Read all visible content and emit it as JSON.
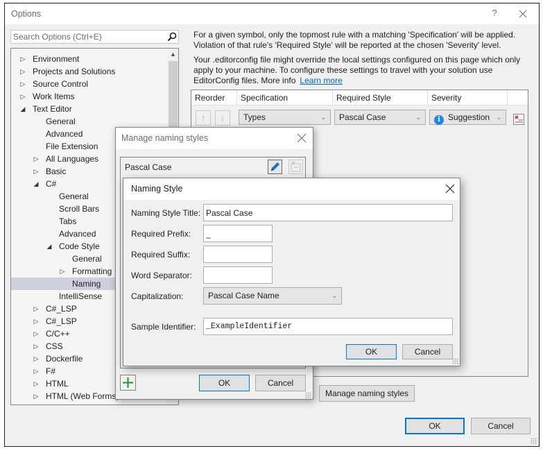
{
  "window": {
    "title": "Options",
    "help_label": "?",
    "close_icon": "close-icon"
  },
  "search": {
    "placeholder": "Search Options (Ctrl+E)",
    "value": ""
  },
  "tree": {
    "items": [
      {
        "label": "Environment",
        "level": 0,
        "arrow": "collapsed"
      },
      {
        "label": "Projects and Solutions",
        "level": 0,
        "arrow": "collapsed"
      },
      {
        "label": "Source Control",
        "level": 0,
        "arrow": "collapsed"
      },
      {
        "label": "Work Items",
        "level": 0,
        "arrow": "collapsed"
      },
      {
        "label": "Text Editor",
        "level": 0,
        "arrow": "expanded"
      },
      {
        "label": "General",
        "level": 1,
        "arrow": "none"
      },
      {
        "label": "Advanced",
        "level": 1,
        "arrow": "none"
      },
      {
        "label": "File Extension",
        "level": 1,
        "arrow": "none"
      },
      {
        "label": "All Languages",
        "level": 1,
        "arrow": "collapsed"
      },
      {
        "label": "Basic",
        "level": 1,
        "arrow": "collapsed"
      },
      {
        "label": "C#",
        "level": 1,
        "arrow": "expanded"
      },
      {
        "label": "General",
        "level": 2,
        "arrow": "none"
      },
      {
        "label": "Scroll Bars",
        "level": 2,
        "arrow": "none"
      },
      {
        "label": "Tabs",
        "level": 2,
        "arrow": "none"
      },
      {
        "label": "Advanced",
        "level": 2,
        "arrow": "none"
      },
      {
        "label": "Code Style",
        "level": 2,
        "arrow": "expanded"
      },
      {
        "label": "General",
        "level": 3,
        "arrow": "none"
      },
      {
        "label": "Formatting",
        "level": 3,
        "arrow": "collapsed"
      },
      {
        "label": "Naming",
        "level": 3,
        "arrow": "none",
        "selected": true
      },
      {
        "label": "IntelliSense",
        "level": 2,
        "arrow": "none"
      },
      {
        "label": "C#_LSP",
        "level": 1,
        "arrow": "collapsed"
      },
      {
        "label": "C#_LSP",
        "level": 1,
        "arrow": "collapsed"
      },
      {
        "label": "C/C++",
        "level": 1,
        "arrow": "collapsed"
      },
      {
        "label": "CSS",
        "level": 1,
        "arrow": "collapsed"
      },
      {
        "label": "Dockerfile",
        "level": 1,
        "arrow": "collapsed"
      },
      {
        "label": "F#",
        "level": 1,
        "arrow": "collapsed"
      },
      {
        "label": "HTML",
        "level": 1,
        "arrow": "collapsed"
      },
      {
        "label": "HTML (Web Forms)",
        "level": 1,
        "arrow": "collapsed"
      }
    ]
  },
  "content": {
    "description_1": "For a given symbol, only the topmost rule with a matching 'Specification' will be applied. Violation of that rule's 'Required Style' will be reported at the chosen 'Severity' level.",
    "description_2": "Your .editorconfig file might override the local settings configured on this page which only apply to your machine. To configure these settings to travel with your solution use EditorConfig files. More info",
    "learn_more": "Learn more",
    "grid": {
      "columns": [
        "Reorder",
        "Specification",
        "Required Style",
        "Severity"
      ],
      "rows": [
        {
          "specification": "Types",
          "required_style": "Pascal Case",
          "severity": "Suggestion"
        }
      ]
    },
    "manage_naming_styles_label": "Manage naming styles",
    "ok_label": "OK",
    "cancel_label": "Cancel"
  },
  "manage_dialog": {
    "title": "Manage naming styles",
    "items": [
      "Pascal Case"
    ],
    "ok_label": "OK",
    "cancel_label": "Cancel"
  },
  "naming_dialog": {
    "title": "Naming Style",
    "fields": {
      "title_label": "Naming Style Title:",
      "title_value": "Pascal Case",
      "prefix_label": "Required Prefix:",
      "prefix_value": "_",
      "suffix_label": "Required Suffix:",
      "suffix_value": "",
      "separator_label": "Word Separator:",
      "separator_value": "",
      "capitalization_label": "Capitalization:",
      "capitalization_value": "Pascal Case Name",
      "sample_label": "Sample Identifier:",
      "sample_value": "_ExampleIdentifier"
    },
    "ok_label": "OK",
    "cancel_label": "Cancel"
  },
  "colors": {
    "accent": "#0078d7",
    "selection": "#cdd0dc",
    "link": "#0066cc",
    "info": "#1e88e5",
    "add_green": "#2e8b2e"
  }
}
